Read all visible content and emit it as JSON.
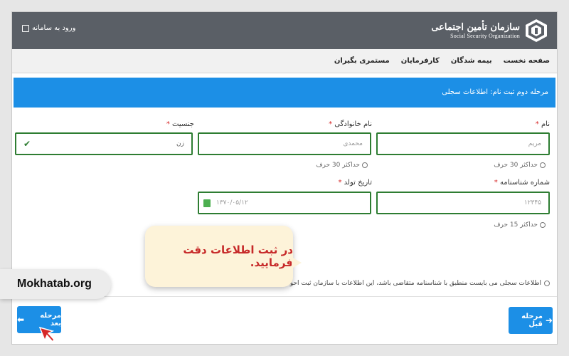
{
  "header": {
    "login_label": "ورود به سامانه",
    "org_name_fa": "سازمان تأمین اجتماعی",
    "org_name_en": "Social Security Organization"
  },
  "nav": {
    "items": [
      {
        "label": "صفحه نخست"
      },
      {
        "label": "بیمه شدگان"
      },
      {
        "label": "کارفرمایان"
      },
      {
        "label": "مستمری بگیران"
      }
    ]
  },
  "step": {
    "title": "مرحله دوم ثبت نام: اطلاعات سجلی"
  },
  "form": {
    "first_name": {
      "label": "نام",
      "required_mark": "*",
      "value": "مریم",
      "hint": "حداکثر 30 حرف"
    },
    "last_name": {
      "label": "نام خانوادگی",
      "required_mark": "*",
      "value": "محمدی",
      "hint": "حداکثر 30 حرف"
    },
    "gender": {
      "label": "جنسیت",
      "required_mark": "*",
      "value": "زن"
    },
    "id_number": {
      "label": "شماره شناسنامه",
      "required_mark": "*",
      "value": "۱۲۳۴۵",
      "hint": "حداکثر 15 حرف"
    },
    "birth_date": {
      "label": "تاریخ تولد",
      "required_mark": "*",
      "value": "۱۳۷۰/۰۵/۱۲"
    },
    "note": "اطلاعات سجلی می بایست منطبق با شناسنامه متقاضی باشد، این اطلاعات با سازمان ثبت احوال کنترل خواهد شد."
  },
  "tooltip": {
    "text": "در ثبت اطلاعات دقت فرمایید."
  },
  "watermark": {
    "text": "Mokhatab.org"
  },
  "buttons": {
    "next": "مرحله بعد",
    "previous": "مرحله قبل"
  },
  "colors": {
    "accent": "#1c8fe6",
    "field_border": "#2e7d32",
    "required": "#d62828",
    "topbar": "#5a5f66"
  }
}
